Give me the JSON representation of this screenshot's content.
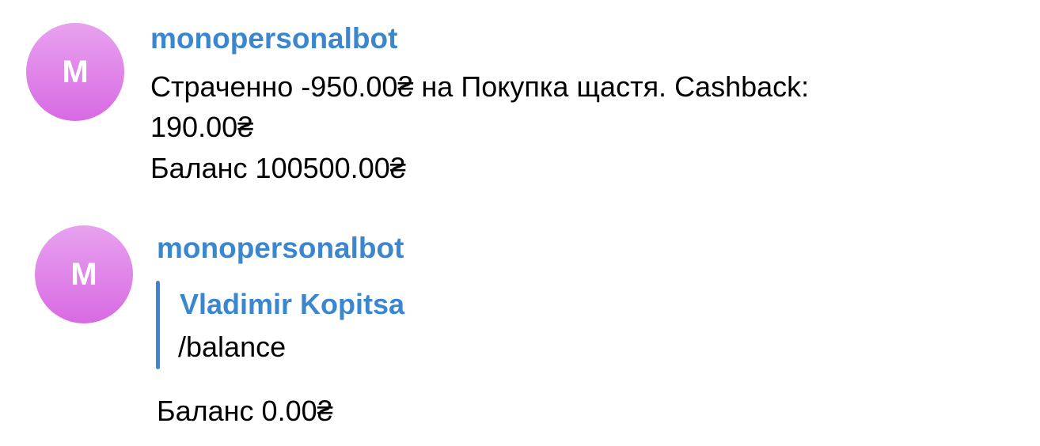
{
  "messages": [
    {
      "avatar_letter": "M",
      "sender": "monopersonalbot",
      "lines": [
        "Страченно -950.00₴ на Покупка щастя. Cashback:",
        "190.00₴",
        "Баланс 100500.00₴"
      ]
    },
    {
      "avatar_letter": "M",
      "sender": "monopersonalbot",
      "reply": {
        "author": "Vladimir Kopitsa",
        "text": "/balance"
      },
      "lines": [
        "Баланс 0.00₴"
      ]
    }
  ],
  "colors": {
    "accent": "#3a86cf",
    "avatar_gradient_top": "#e8a2ef",
    "avatar_gradient_bottom": "#d86ae3"
  }
}
